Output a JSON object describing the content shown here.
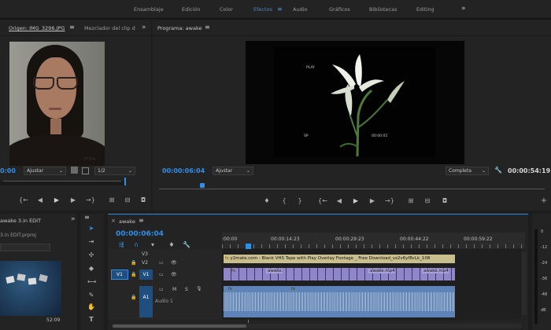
{
  "workspaces": [
    "Ensamblaje",
    "Edición",
    "Color",
    "Efectos",
    "Audio",
    "Gráficos",
    "Bibliotecas",
    "Editing"
  ],
  "active_workspace": "Efectos",
  "source": {
    "tab_origin": "Origen: IMG_3296.JPG",
    "tab_mixer": "Mezclador del clip d",
    "timecode": "0:00",
    "fit": "Ajustar",
    "zoom": "1/2",
    "watermark": "ST/DA"
  },
  "program": {
    "title": "Programa: awake",
    "timecode": "00:00:06:04",
    "fit": "Ajustar",
    "quality": "Completa",
    "duration": "00:00:54:19",
    "vhs_play": "PLAY",
    "vhs_sp": "SP",
    "vhs_time": "00:00:05"
  },
  "project": {
    "title": "awake 3.in EDIT",
    "file": "3.in EDIT.prproj",
    "thumb_duration": "52:09"
  },
  "timeline": {
    "tab": "awake",
    "timecode": "00:00:06:04",
    "ruler": [
      ":00:00",
      "00:00:14:23",
      "00:00:29:23",
      "00:00:44:22",
      "00:00:59:22"
    ],
    "tracks": {
      "v3": "V3",
      "v2": "V2",
      "v1": "V1",
      "a1": "A1",
      "src_v1": "V1",
      "audio_name": "Audio 1"
    },
    "clips": {
      "v2_title": "y2mate.com - Blank VHS Tape with Play Overlay Footage _ Free Download_vz2v6yf8cLk_108",
      "v1_a": "awake.",
      "v1_b": "awake.mp4",
      "v1_c": "awake.mp4"
    },
    "fx": "fx"
  },
  "meter": {
    "labels": [
      "0",
      "-12",
      "-24",
      "-36",
      "-48",
      "dB"
    ]
  },
  "colors": {
    "accent": "#2f8ee6",
    "v2_clip": "#c9bf8e",
    "v1_clip": "#8f86c9",
    "audio_clip": "#5d83b8"
  }
}
